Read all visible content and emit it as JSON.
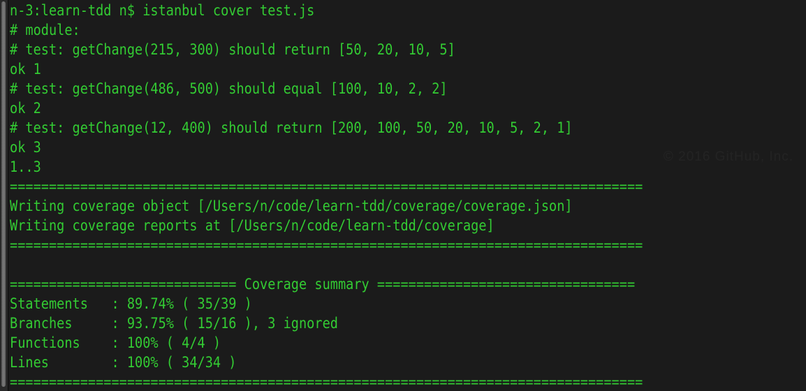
{
  "terminal": {
    "background_color": "#1b1b1b",
    "text_color": "#33cc33",
    "scrollbar_color": "#6e6e6e",
    "watermark": "© 2016 GitHub, Inc.",
    "lines": [
      "n-3:learn-tdd n$ istanbul cover test.js",
      "# module:",
      "# test: getChange(215, 300) should return [50, 20, 10, 5]",
      "ok 1",
      "# test: getChange(486, 500) should equal [100, 10, 2, 2]",
      "ok 2",
      "# test: getChange(12, 400) should return [200, 100, 50, 20, 10, 5, 2, 1]",
      "ok 3",
      "1..3",
      "=================================================================================",
      "Writing coverage object [/Users/n/code/learn-tdd/coverage/coverage.json]",
      "Writing coverage reports at [/Users/n/code/learn-tdd/coverage]",
      "=================================================================================",
      "",
      "============================= Coverage summary =================================",
      "Statements   : 89.74% ( 35/39 )",
      "Branches     : 93.75% ( 15/16 ), 3 ignored",
      "Functions    : 100% ( 4/4 )",
      "Lines        : 100% ( 34/34 )",
      "================================================================================="
    ],
    "command": {
      "prompt": "n-3:learn-tdd n$",
      "text": "istanbul cover test.js"
    },
    "tap_output": {
      "module_label": "# module:",
      "tests": [
        {
          "description": "# test: getChange(215, 300) should return [50, 20, 10, 5]",
          "result": "ok 1"
        },
        {
          "description": "# test: getChange(486, 500) should equal [100, 10, 2, 2]",
          "result": "ok 2"
        },
        {
          "description": "# test: getChange(12, 400) should return [200, 100, 50, 20, 10, 5, 2, 1]",
          "result": "ok 3"
        }
      ],
      "plan": "1..3"
    },
    "coverage_writes": [
      "Writing coverage object [/Users/n/code/learn-tdd/coverage/coverage.json]",
      "Writing coverage reports at [/Users/n/code/learn-tdd/coverage]"
    ],
    "coverage_summary": {
      "heading": "Coverage summary",
      "rows": [
        {
          "label": "Statements",
          "separator": ":",
          "percent": "89.74%",
          "ratio": "( 35/39 )",
          "note": ""
        },
        {
          "label": "Branches",
          "separator": ":",
          "percent": "93.75%",
          "ratio": "( 15/16 )",
          "note": ", 3 ignored"
        },
        {
          "label": "Functions",
          "separator": ":",
          "percent": "100%",
          "ratio": "( 4/4 )",
          "note": ""
        },
        {
          "label": "Lines",
          "separator": ":",
          "percent": "100%",
          "ratio": "( 34/34 )",
          "note": ""
        }
      ]
    }
  }
}
